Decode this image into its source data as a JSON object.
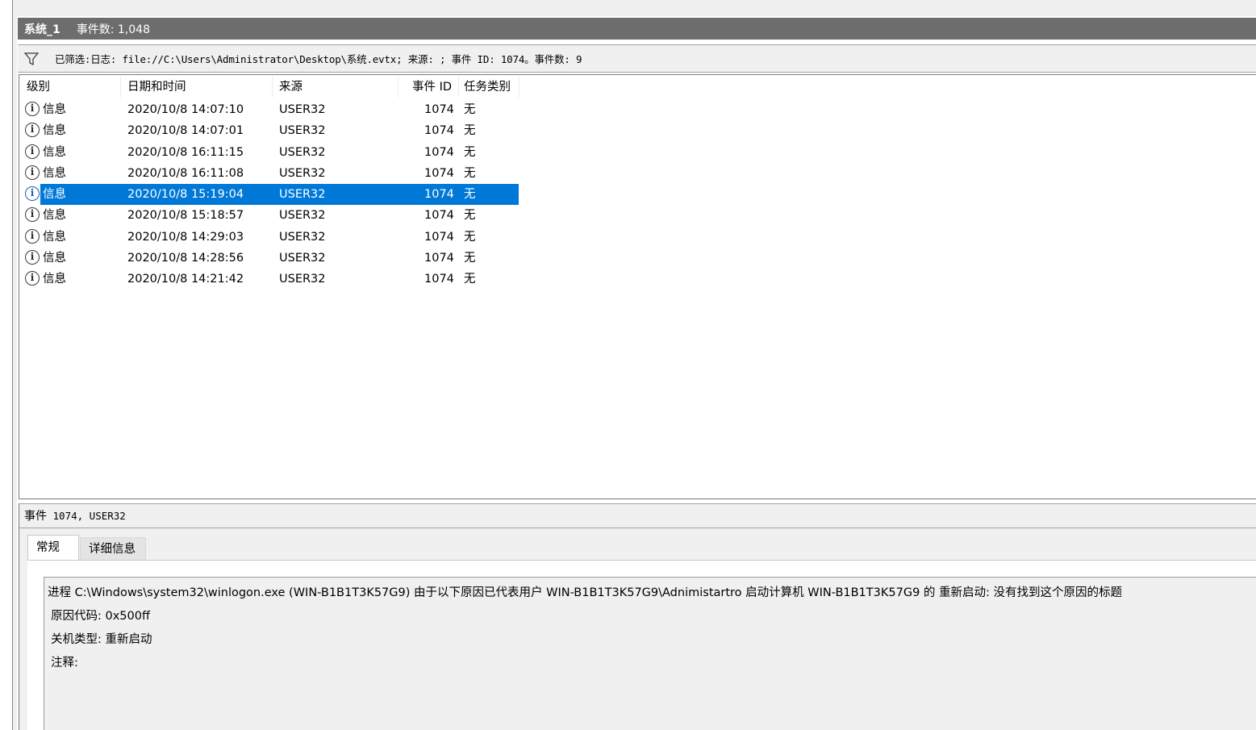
{
  "window": {
    "log_name": "系统_1",
    "event_count": "事件数: 1,048"
  },
  "filter": {
    "icon": "funnel-icon",
    "text": "已筛选:日志: file://C:\\Users\\Administrator\\Desktop\\系统.evtx; 来源: ; 事件 ID: 1074。事件数: 9"
  },
  "table": {
    "columns": [
      "级别",
      "日期和时间",
      "来源",
      "事件 ID",
      "任务类别"
    ],
    "rows": [
      {
        "level": "信息",
        "datetime": "2020/10/8 14:07:10",
        "source": "USER32",
        "event_id": "1074",
        "task": "无"
      },
      {
        "level": "信息",
        "datetime": "2020/10/8 14:07:01",
        "source": "USER32",
        "event_id": "1074",
        "task": "无"
      },
      {
        "level": "信息",
        "datetime": "2020/10/8 16:11:15",
        "source": "USER32",
        "event_id": "1074",
        "task": "无"
      },
      {
        "level": "信息",
        "datetime": "2020/10/8 16:11:08",
        "source": "USER32",
        "event_id": "1074",
        "task": "无"
      },
      {
        "level": "信息",
        "datetime": "2020/10/8 15:19:04",
        "source": "USER32",
        "event_id": "1074",
        "task": "无",
        "selected": true
      },
      {
        "level": "信息",
        "datetime": "2020/10/8 15:18:57",
        "source": "USER32",
        "event_id": "1074",
        "task": "无"
      },
      {
        "level": "信息",
        "datetime": "2020/10/8 14:29:03",
        "source": "USER32",
        "event_id": "1074",
        "task": "无"
      },
      {
        "level": "信息",
        "datetime": "2020/10/8 14:28:56",
        "source": "USER32",
        "event_id": "1074",
        "task": "无"
      },
      {
        "level": "信息",
        "datetime": "2020/10/8 14:21:42",
        "source": "USER32",
        "event_id": "1074",
        "task": "无"
      }
    ],
    "selection_color": "#0078d7"
  },
  "detail": {
    "title_prefix": "事件",
    "title_rest": " 1074, USER32",
    "tabs": [
      "常规",
      "详细信息"
    ],
    "lines": [
      "进程 C:\\Windows\\system32\\winlogon.exe (WIN-B1B1T3K57G9) 由于以下原因已代表用户 WIN-B1B1T3K57G9\\Adnimistartro 启动计算机 WIN-B1B1T3K57G9 的 重新启动: 没有找到这个原因的标题",
      "原因代码: 0x500ff",
      "关机类型: 重新启动",
      "注释:"
    ]
  },
  "colors": {
    "titlebar": "#6d6d6d",
    "pane_bg": "#f0f0f0"
  }
}
